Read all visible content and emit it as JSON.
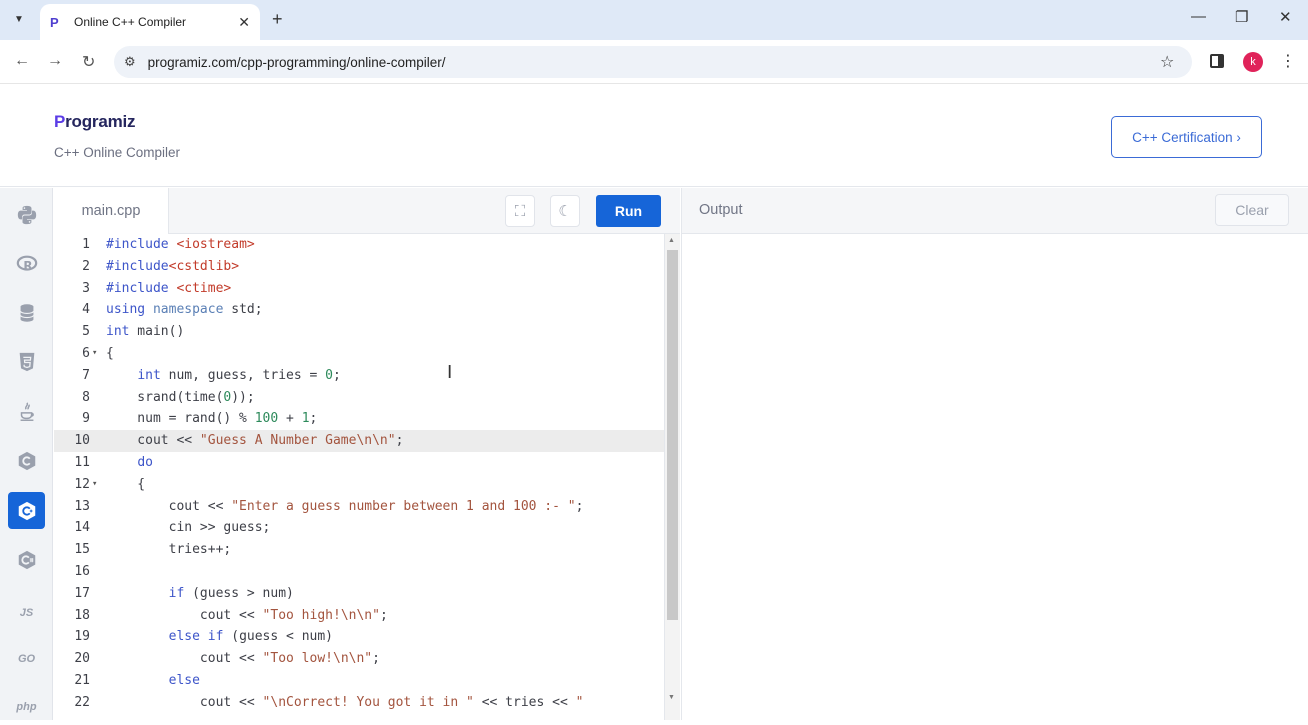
{
  "browser": {
    "tab_title": "Online C++ Compiler",
    "url": "programiz.com/cpp-programming/online-compiler/",
    "profile_initial": "k"
  },
  "site": {
    "logo_mark": "P",
    "logo_text": "rogramiz",
    "subtitle": "C++ Online Compiler",
    "certification_label": "C++ Certification ›"
  },
  "sidebar": {
    "languages": [
      "python",
      "r",
      "sql",
      "html",
      "java",
      "c",
      "cpp",
      "csharp",
      "js",
      "go",
      "php"
    ],
    "active": "cpp",
    "js_label": "JS",
    "go_label": "GO",
    "php_label": "php"
  },
  "editor": {
    "filename": "main.cpp",
    "run_label": "Run",
    "active_line": 10,
    "lines": [
      "#include <iostream>",
      "#include<cstdlib>",
      "#include <ctime>",
      "using namespace std;",
      "int main()",
      "{",
      "    int num, guess, tries = 0;",
      "    srand(time(0));",
      "    num = rand() % 100 + 1;",
      "    cout << \"Guess A Number Game\\n\\n\";",
      "    do",
      "    {",
      "        cout << \"Enter a guess number between 1 and 100 :- \";",
      "        cin >> guess;",
      "        tries++;",
      "",
      "        if (guess > num)",
      "            cout << \"Too high!\\n\\n\";",
      "        else if (guess < num)",
      "            cout << \"Too low!\\n\\n\";",
      "        else",
      "            cout << \"\\nCorrect! You got it in \" << tries << \""
    ]
  },
  "output": {
    "label": "Output",
    "clear_label": "Clear"
  }
}
